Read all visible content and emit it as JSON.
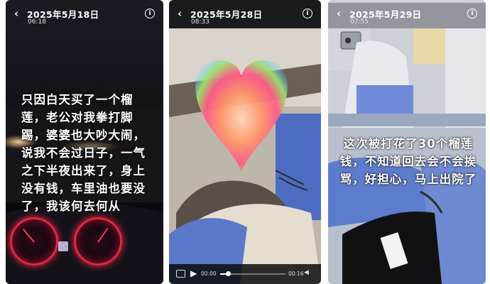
{
  "panels": [
    {
      "date": "2025年5月18日",
      "time": "06:18",
      "caption": "只因白天买了一个榴莲，老公对我拳打脚踢，婆婆也大吵大闹，说我不会过日子，一气之下半夜出来了，身上没有钱，车里油也要没了，我该何去何从"
    },
    {
      "date": "2025年5月28日",
      "time": "08:33",
      "video": {
        "current": "00:00",
        "duration": "00:16",
        "progress": 0.12
      }
    },
    {
      "date": "2025年5月29日",
      "time": "07:55",
      "caption": "这次被打花了30个榴莲钱，不知道回去会不会挨骂，好担心，马上出院了"
    }
  ],
  "icons": {
    "back": "‹",
    "info": "i"
  }
}
